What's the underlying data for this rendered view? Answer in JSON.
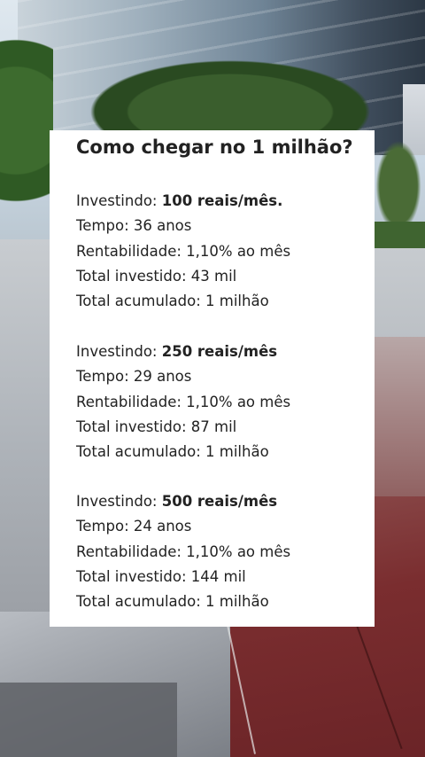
{
  "card": {
    "title": "Como chegar no 1 milhão?",
    "scenarios": [
      {
        "investindo_label": "Investindo:",
        "investindo_value": "100 reais/mês.",
        "tempo": "Tempo: 36 anos",
        "rentabilidade": "Rentabilidade: 1,10% ao mês",
        "total_investido": "Total investido: 43 mil",
        "total_acumulado": "Total acumulado: 1 milhão"
      },
      {
        "investindo_label": "Investindo:",
        "investindo_value": "250 reais/mês",
        "tempo": "Tempo: 29 anos",
        "rentabilidade": "Rentabilidade: 1,10% ao mês",
        "total_investido": "Total investido: 87 mil",
        "total_acumulado": "Total acumulado: 1 milhão"
      },
      {
        "investindo_label": "Investindo:",
        "investindo_value": "500 reais/mês",
        "tempo": "Tempo: 24 anos",
        "rentabilidade": "Rentabilidade: 1,10% ao mês",
        "total_investido": "Total investido: 144 mil",
        "total_acumulado": "Total acumulado: 1 milhão"
      }
    ]
  },
  "colors": {
    "card_background": "#ffffff",
    "text": "#222222"
  }
}
